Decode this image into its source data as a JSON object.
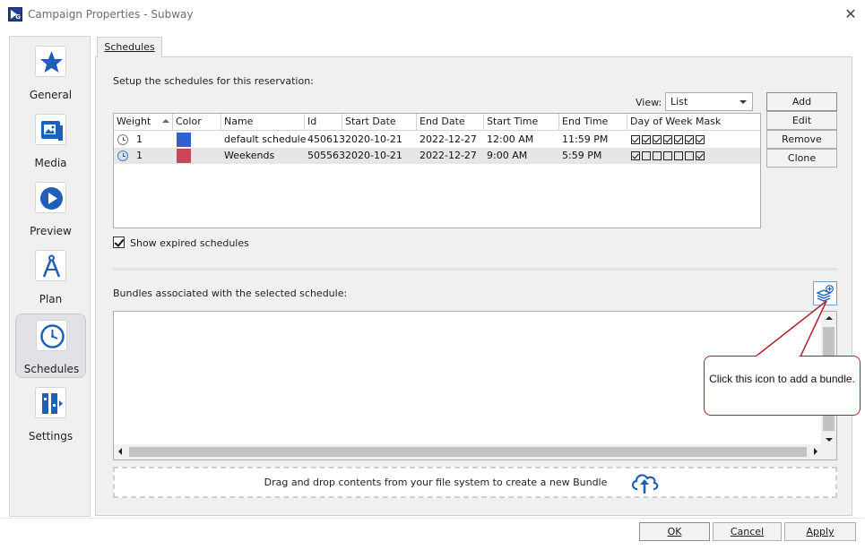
{
  "window": {
    "title": "Campaign Properties - Subway",
    "close_glyph": "✕"
  },
  "nav": {
    "items": [
      {
        "label": "General",
        "icon": "star-icon"
      },
      {
        "label": "Media",
        "icon": "media-icon"
      },
      {
        "label": "Preview",
        "icon": "play-icon"
      },
      {
        "label": "Plan",
        "icon": "compass-icon"
      },
      {
        "label": "Schedules",
        "icon": "clock-icon",
        "selected": true
      },
      {
        "label": "Settings",
        "icon": "settings-icon"
      }
    ]
  },
  "tab": {
    "label": "Schedules"
  },
  "schedules": {
    "setup_label": "Setup the schedules for this reservation:",
    "view_label": "View:",
    "view_value": "List",
    "buttons": {
      "add": "Add",
      "edit": "Edit",
      "remove": "Remove",
      "clone": "Clone"
    },
    "columns": [
      "Weight",
      "Color",
      "Name",
      "Id",
      "Start Date",
      "End Date",
      "Start Time",
      "End Time",
      "Day of Week Mask"
    ],
    "rows": [
      {
        "weight": "1",
        "color": "#2f62d0",
        "name": "default schedule",
        "id": "450613",
        "start_date": "2020-10-21",
        "end_date": "2022-12-27",
        "start_time": "12:00 AM",
        "end_time": "11:59 PM",
        "dow_mask": [
          true,
          true,
          true,
          true,
          true,
          true,
          true
        ]
      },
      {
        "weight": "1",
        "color": "#c8485a",
        "name": "Weekends",
        "id": "505563",
        "start_date": "2020-10-21",
        "end_date": "2022-12-27",
        "start_time": "9:00 AM",
        "end_time": "5:59 PM",
        "dow_mask": [
          true,
          false,
          false,
          false,
          false,
          false,
          true
        ]
      }
    ],
    "show_expired_label": "Show expired schedules",
    "show_expired_checked": true
  },
  "bundles": {
    "label": "Bundles associated with the selected schedule:",
    "dropzone_text": "Drag and drop contents from your file system to create a new Bundle"
  },
  "callout": {
    "text": "Click this icon to add a bundle."
  },
  "footer": {
    "ok": "OK",
    "cancel": "Cancel",
    "apply": "Apply"
  },
  "colors": {
    "accent": "#1f5fb8",
    "callout_border": "#b0202a"
  }
}
